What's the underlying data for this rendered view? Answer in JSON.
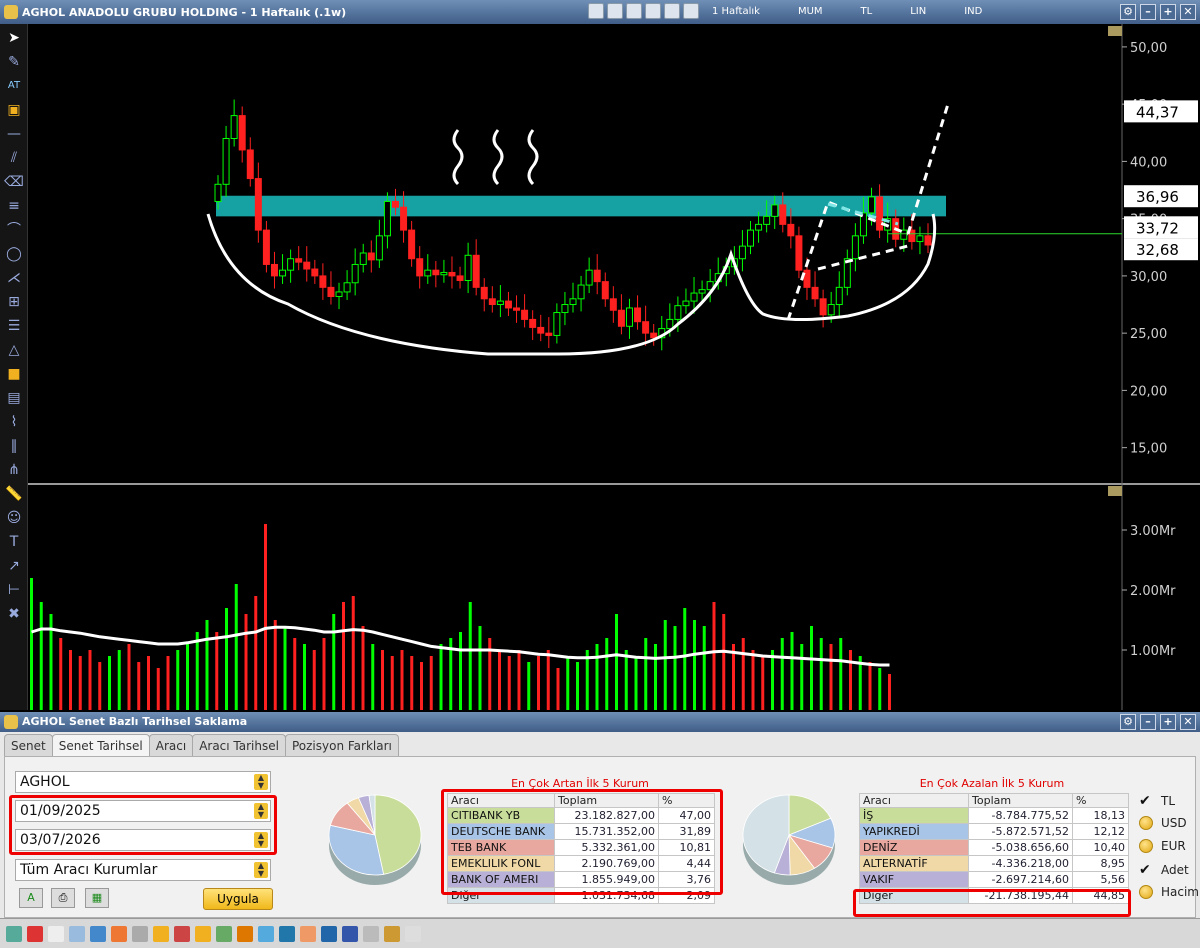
{
  "window": {
    "title": "AGHOL ANADOLU GRUBU HOLDING - 1 Haftalık (.1w)"
  },
  "title_toolbar": {
    "period": "1 Haftalık",
    "chart_type": "MUM",
    "currency": "TL",
    "scale": "LIN",
    "mode": "IND"
  },
  "chart_data": [
    {
      "type": "candlestick",
      "title": "",
      "ylim": [
        12,
        52
      ],
      "y_ticks": [
        "50,00",
        "45,00",
        "40,00",
        "35,00",
        "30,00",
        "25,00",
        "20,00",
        "15,00"
      ],
      "price_tags": [
        {
          "value": 44.37,
          "label": "44,37"
        },
        {
          "value": 36.96,
          "label": "36,96"
        },
        {
          "value": 33.72,
          "label": "33,72"
        },
        {
          "value": 32.68,
          "label": "32,68"
        }
      ],
      "resistance_zone": [
        35.2,
        37.0
      ],
      "close": [
        38.0,
        42.0,
        44.0,
        41.0,
        38.5,
        34.0,
        31.0,
        30.0,
        30.5,
        31.5,
        31.2,
        30.6,
        30.0,
        29.0,
        28.2,
        28.6,
        29.4,
        31.0,
        32.0,
        31.4,
        33.5,
        36.5,
        36.0,
        34.0,
        31.5,
        30.0,
        30.5,
        30.1,
        30.3,
        30.0,
        29.6,
        31.8,
        29.0,
        28.0,
        27.5,
        27.8,
        27.2,
        27.0,
        26.2,
        25.5,
        25.0,
        24.8,
        26.8,
        27.5,
        28.0,
        29.2,
        30.5,
        29.5,
        28.0,
        27.0,
        25.6,
        27.2,
        26.0,
        25.0,
        24.6,
        25.4,
        26.2,
        27.4,
        27.8,
        28.5,
        28.8,
        29.5,
        30.2,
        30.8,
        31.5,
        32.6,
        34.0,
        34.5,
        35.2,
        36.2,
        34.5,
        33.5,
        30.5,
        29.0,
        28.0,
        26.6,
        27.5,
        29.0,
        31.5,
        33.5,
        35.5,
        36.9,
        34.0,
        35.0,
        33.2,
        34.0,
        33.0,
        33.5,
        32.7
      ],
      "up_color": "#00ff00",
      "down_color": "#ff2020"
    },
    {
      "type": "bar",
      "title": "",
      "ylim": [
        0,
        3.6
      ],
      "y_ticks": [
        "3.00Mr",
        "2.00Mr",
        "1.00Mr"
      ],
      "values": [
        2.2,
        1.8,
        1.6,
        1.2,
        1.0,
        0.9,
        1.0,
        0.8,
        0.9,
        1.0,
        1.1,
        0.8,
        0.9,
        0.7,
        0.9,
        1.0,
        1.1,
        1.3,
        1.5,
        1.3,
        1.7,
        2.1,
        1.6,
        1.9,
        3.1,
        1.5,
        1.4,
        1.2,
        1.1,
        1.0,
        1.2,
        1.6,
        1.8,
        1.9,
        1.4,
        1.1,
        1.0,
        0.9,
        1.0,
        0.9,
        0.8,
        0.9,
        1.1,
        1.2,
        1.3,
        1.8,
        1.4,
        1.2,
        1.0,
        0.9,
        1.0,
        0.8,
        0.9,
        1.0,
        0.7,
        0.9,
        0.8,
        1.0,
        1.1,
        1.2,
        1.6,
        1.0,
        0.9,
        1.2,
        1.1,
        1.5,
        1.4,
        1.7,
        1.5,
        1.4,
        1.8,
        1.6,
        1.1,
        1.2,
        1.0,
        0.9,
        1.0,
        1.2,
        1.3,
        1.1,
        1.4,
        1.2,
        1.1,
        1.2,
        1.0,
        0.9,
        0.8,
        0.7,
        0.6
      ],
      "average": [
        1.3,
        1.35,
        1.35,
        1.32,
        1.3,
        1.28,
        1.25,
        1.22,
        1.2,
        1.18,
        1.16,
        1.14,
        1.12,
        1.1,
        1.1,
        1.1,
        1.12,
        1.15,
        1.18,
        1.2,
        1.22,
        1.25,
        1.28,
        1.3,
        1.36,
        1.38,
        1.38,
        1.37,
        1.35,
        1.33,
        1.3,
        1.3,
        1.32,
        1.34,
        1.33,
        1.3,
        1.26,
        1.22,
        1.18,
        1.14,
        1.1,
        1.06,
        1.04,
        1.02,
        1.0,
        1.0,
        1.0,
        1.0,
        0.99,
        0.98,
        0.97,
        0.95,
        0.93,
        0.92,
        0.9,
        0.88,
        0.87,
        0.87,
        0.88,
        0.9,
        0.92,
        0.9,
        0.88,
        0.87,
        0.86,
        0.87,
        0.88,
        0.9,
        0.93,
        0.95,
        0.97,
        0.98,
        0.96,
        0.94,
        0.92,
        0.9,
        0.89,
        0.88,
        0.87,
        0.86,
        0.85,
        0.84,
        0.83,
        0.82,
        0.8,
        0.78,
        0.76,
        0.75,
        0.75
      ],
      "up_color": "#00ff00",
      "down_color": "#ff2020"
    }
  ],
  "lower_window": {
    "title": "AGHOL Senet Bazlı Tarihsel Saklama",
    "tabs": [
      "Senet",
      "Senet Tarihsel",
      "Aracı",
      "Aracı Tarihsel",
      "Pozisyon Farkları"
    ],
    "symbol": "AGHOL",
    "start_date": "01/09/2025",
    "end_date": "03/07/2026",
    "broker_filter": "Tüm Aracı Kurumlar",
    "apply_label": "Uygula",
    "gainers": {
      "title": "En Çok Artan İlk 5 Kurum",
      "headers": [
        "Aracı",
        "Toplam",
        "%"
      ],
      "rows": [
        {
          "name": "CITIBANK YB",
          "total": "23.182.827,00",
          "pct": "47,00",
          "color": "#c9dd9a",
          "share": 47.0
        },
        {
          "name": "DEUTSCHE BANK",
          "total": "15.731.352,00",
          "pct": "31,89",
          "color": "#a8c4e6",
          "share": 31.89
        },
        {
          "name": "TEB BANK",
          "total": "5.332.361,00",
          "pct": "10,81",
          "color": "#e8a8a0",
          "share": 10.81
        },
        {
          "name": "EMEKLILIK FONL",
          "total": "2.190.769,00",
          "pct": "4,44",
          "color": "#f0d9a6",
          "share": 4.44
        },
        {
          "name": "BANK OF AMERI",
          "total": "1.855.949,00",
          "pct": "3,76",
          "color": "#b8b0d6",
          "share": 3.76
        },
        {
          "name": "Diğer",
          "total": "1.031.734,68",
          "pct": "2,09",
          "color": "#d4e1e6",
          "share": 2.09
        }
      ]
    },
    "losers": {
      "title": "En Çok Azalan İlk 5 Kurum",
      "headers": [
        "Aracı",
        "Toplam",
        "%"
      ],
      "rows": [
        {
          "name": "İŞ",
          "total": "-8.784.775,52",
          "pct": "18,13",
          "color": "#c9dd9a",
          "share": 18.13
        },
        {
          "name": "YAPIKREDİ",
          "total": "-5.872.571,52",
          "pct": "12,12",
          "color": "#a8c4e6",
          "share": 12.12
        },
        {
          "name": "DENİZ",
          "total": "-5.038.656,60",
          "pct": "10,40",
          "color": "#e8a8a0",
          "share": 10.4
        },
        {
          "name": "ALTERNATİF",
          "total": "-4.336.218,00",
          "pct": "8,95",
          "color": "#f0d9a6",
          "share": 8.95
        },
        {
          "name": "VAKIF",
          "total": "-2.697.214,60",
          "pct": "5,56",
          "color": "#b8b0d6",
          "share": 5.56
        },
        {
          "name": "Diğer",
          "total": "-21.738.195,44",
          "pct": "44,85",
          "color": "#d4e1e6",
          "share": 44.85
        }
      ]
    },
    "options": [
      {
        "label": "TL",
        "checked": true
      },
      {
        "label": "USD",
        "checked": false
      },
      {
        "label": "EUR",
        "checked": false
      },
      {
        "label": "Adet",
        "checked": true
      },
      {
        "label": "Hacim",
        "checked": false
      }
    ]
  }
}
